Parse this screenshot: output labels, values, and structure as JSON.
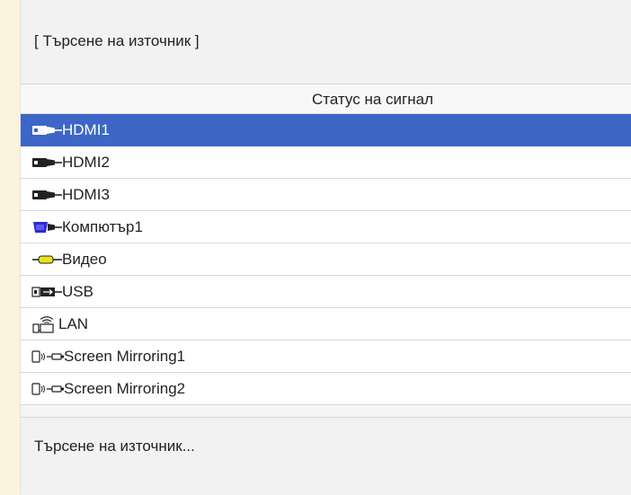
{
  "title": "[ Търсене на източник ]",
  "header": {
    "column": "Статус на сигнал"
  },
  "sources": [
    {
      "label": "HDMI1",
      "icon": "hdmi-icon",
      "selected": true
    },
    {
      "label": "HDMI2",
      "icon": "hdmi-icon",
      "selected": false
    },
    {
      "label": "HDMI3",
      "icon": "hdmi-icon",
      "selected": false
    },
    {
      "label": "Компютър1",
      "icon": "vga-computer-icon",
      "selected": false
    },
    {
      "label": "Видео",
      "icon": "video-rca-icon",
      "selected": false
    },
    {
      "label": "USB",
      "icon": "usb-icon",
      "selected": false
    },
    {
      "label": "LAN",
      "icon": "lan-wireless-icon",
      "selected": false
    },
    {
      "label": "Screen Mirroring1",
      "icon": "screen-mirroring-icon",
      "selected": false
    },
    {
      "label": "Screen Mirroring2",
      "icon": "screen-mirroring-icon",
      "selected": false
    }
  ],
  "footer": {
    "status": "Търсене на източник..."
  },
  "colors": {
    "selected": "#3d66c7",
    "panel": "#f5f5f5",
    "outer": "#fcf3df"
  }
}
